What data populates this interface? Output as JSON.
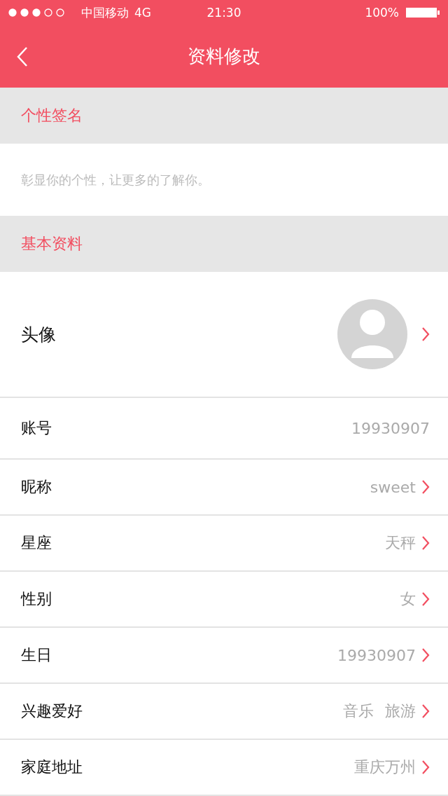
{
  "status_bar": {
    "carrier": "中国移动",
    "network": "4G",
    "time": "21:30",
    "battery": "100%"
  },
  "header": {
    "title": "资料修改"
  },
  "sections": [
    {
      "title": "个性签名",
      "kind": "signature",
      "placeholder": "彰显你的个性，让更多的了解你。"
    },
    {
      "title": "基本资料",
      "kind": "list",
      "rows": [
        {
          "kind": "avatar",
          "label": "头像",
          "chevron": true
        },
        {
          "kind": "text",
          "label": "账号",
          "values": [
            "19930907"
          ],
          "chevron": false
        },
        {
          "kind": "text",
          "label": "昵称",
          "values": [
            "sweet"
          ],
          "chevron": true
        },
        {
          "kind": "text",
          "label": "星座",
          "values": [
            "天秤"
          ],
          "chevron": true
        },
        {
          "kind": "text",
          "label": "性别",
          "values": [
            "女"
          ],
          "chevron": true
        },
        {
          "kind": "text",
          "label": "生日",
          "values": [
            "19930907"
          ],
          "chevron": true
        },
        {
          "kind": "text",
          "label": "兴趣爱好",
          "values": [
            "音乐",
            "旅游"
          ],
          "chevron": true
        },
        {
          "kind": "text",
          "label": "家庭地址",
          "values": [
            "重庆万州"
          ],
          "chevron": true
        }
      ]
    }
  ]
}
